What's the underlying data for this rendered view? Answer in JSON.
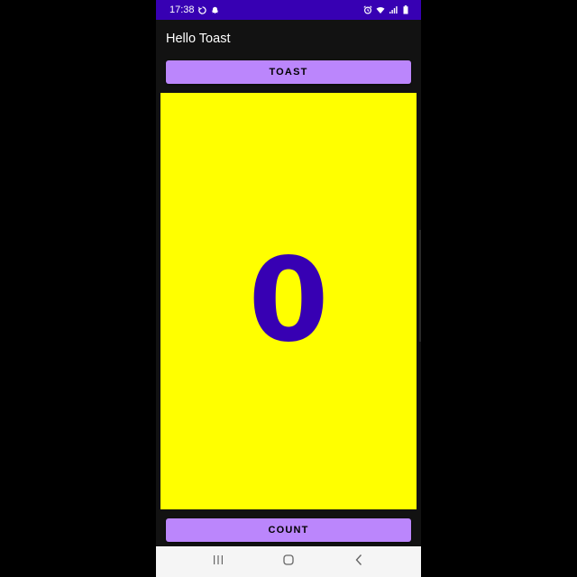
{
  "status_bar": {
    "time": "17:38",
    "left_icons": [
      "sync-icon",
      "snapchat-icon"
    ],
    "right_icons": [
      "alarm-icon",
      "wifi-icon",
      "signal-icon",
      "battery-icon"
    ]
  },
  "app_bar": {
    "title": "Hello Toast"
  },
  "toast_button": {
    "label": "TOAST"
  },
  "counter": {
    "value": "0",
    "background_color": "#ffff00",
    "text_color": "#3700b3"
  },
  "count_button": {
    "label": "COUNT"
  },
  "theme": {
    "button_color": "#bb86fc",
    "status_bar_color": "#3700b3",
    "background_color": "#121212"
  },
  "nav_bar": {
    "buttons": [
      "recents-icon",
      "home-icon",
      "back-icon"
    ]
  }
}
